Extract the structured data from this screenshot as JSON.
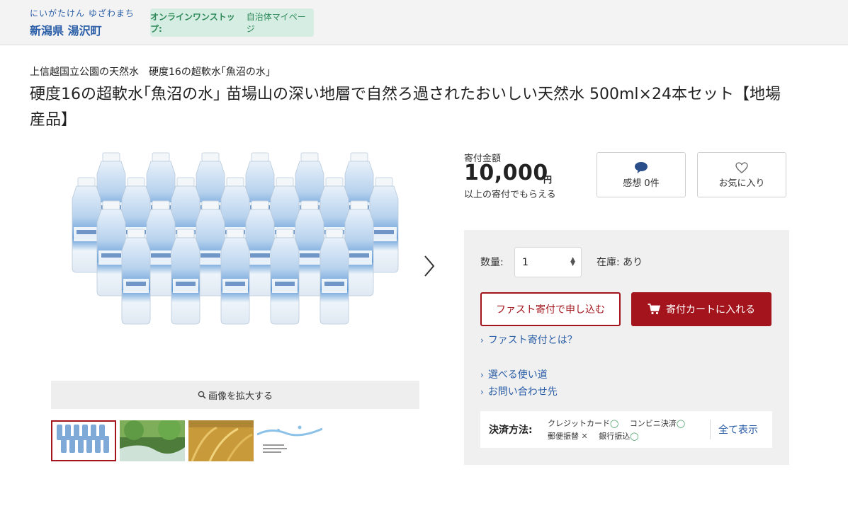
{
  "header": {
    "muni_kana": "にいがたけん ゆざわまち",
    "muni_name": "新潟県 湯沢町",
    "onestop_bold": "オンラインワンストップ:",
    "onestop_text": "自治体マイページ"
  },
  "product": {
    "subtitle": "上信越国立公園の天然水　硬度16の超軟水｢魚沼の水｣",
    "title": "硬度16の超軟水｢魚沼の水｣ 苗場山の深い地層で自然ろ過されたおいしい天然水 500ml×24本セット【地場産品】",
    "zoom_label": "画像を拡大する",
    "thumbnails": [
      {
        "name": "bottles",
        "selected": true
      },
      {
        "name": "forest-stream",
        "selected": false
      },
      {
        "name": "rice-field",
        "selected": false
      },
      {
        "name": "water-splash",
        "selected": false
      }
    ]
  },
  "donation": {
    "label": "寄付金額",
    "amount": "10,000",
    "unit": "円",
    "note": "以上の寄付でもらえる"
  },
  "actions": {
    "review_label": "感想 0件",
    "favorite_label": "お気に入り"
  },
  "purchase": {
    "qty_label": "数量:",
    "qty_value": "1",
    "stock_label": "在庫: あり",
    "fast_button": "ファスト寄付で申し込む",
    "cart_button": "寄付カートに入れる",
    "link_fast": "ファスト寄付とは？",
    "link_usage": "選べる使い道",
    "link_contact": "お問い合わせ先"
  },
  "payment": {
    "label": "決済方法:",
    "methods_row1": [
      {
        "name": "クレジットカード",
        "mark": "◯"
      },
      {
        "name": "コンビニ決済",
        "mark": "◯"
      }
    ],
    "methods_row2": [
      {
        "name": "郵便振替",
        "mark": "✕"
      },
      {
        "name": "銀行振込",
        "mark": "◯"
      }
    ],
    "show_all": "全て表示"
  },
  "colors": {
    "brand_blue": "#2a5ea7",
    "accent_red": "#a3141c",
    "onestop_bg": "#d5ede2"
  }
}
